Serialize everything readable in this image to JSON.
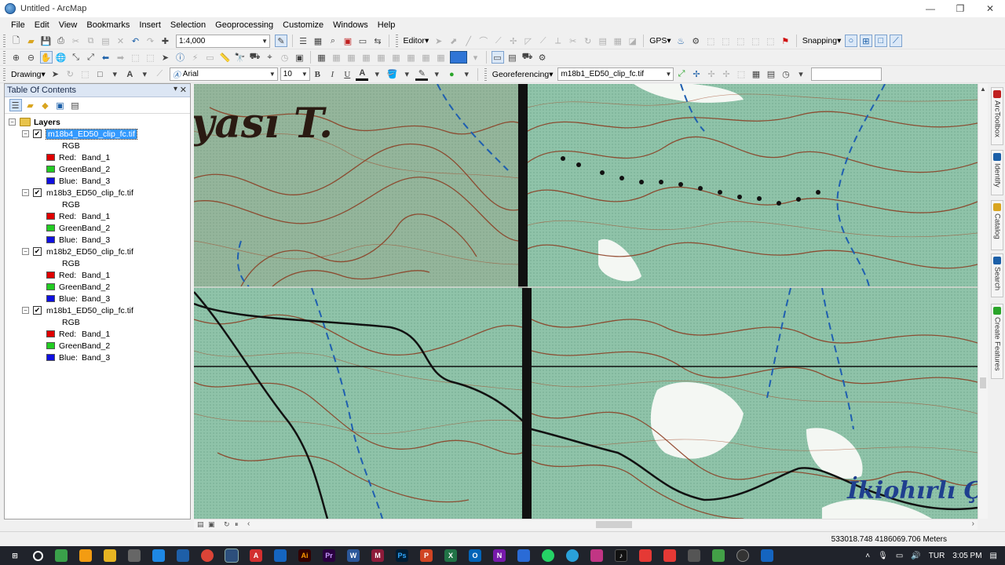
{
  "window": {
    "title": "Untitled - ArcMap",
    "min": "—",
    "restore": "❐",
    "close": "✕"
  },
  "menu": [
    "File",
    "Edit",
    "View",
    "Bookmarks",
    "Insert",
    "Selection",
    "Geoprocessing",
    "Customize",
    "Windows",
    "Help"
  ],
  "toolbar": {
    "scale": "1:4,000",
    "editor_label": "Editor",
    "gps_label": "GPS",
    "snapping_label": "Snapping",
    "drawing_label": "Drawing",
    "font_name": "Arial",
    "font_size": "10",
    "bold": "B",
    "italic": "I",
    "underline": "U",
    "font_color": "A",
    "georef_label": "Georeferencing",
    "georef_layer": "m18b1_ED50_clip_fc.tif"
  },
  "toc": {
    "title": "Table Of Contents",
    "pin": "▾",
    "close": "✕",
    "root": "Layers",
    "layers": [
      {
        "name": "m18b4_ED50_clip_fc.tif",
        "selected": true,
        "checked": true,
        "render": "RGB",
        "bands": [
          {
            "label": "Red:",
            "band": "Band_1",
            "color": "#e00000"
          },
          {
            "label": "Green:",
            "band": "Band_2",
            "color": "#22cc22"
          },
          {
            "label": "Blue:",
            "band": "Band_3",
            "color": "#1010e0"
          }
        ]
      },
      {
        "name": "m18b3_ED50_clip_fc.tif",
        "selected": false,
        "checked": true,
        "render": "RGB",
        "bands": [
          {
            "label": "Red:",
            "band": "Band_1",
            "color": "#e00000"
          },
          {
            "label": "Green:",
            "band": "Band_2",
            "color": "#22cc22"
          },
          {
            "label": "Blue:",
            "band": "Band_3",
            "color": "#1010e0"
          }
        ]
      },
      {
        "name": "m18b2_ED50_clip_fc.tif",
        "selected": false,
        "checked": true,
        "render": "RGB",
        "bands": [
          {
            "label": "Red:",
            "band": "Band_1",
            "color": "#e00000"
          },
          {
            "label": "Green:",
            "band": "Band_2",
            "color": "#22cc22"
          },
          {
            "label": "Blue:",
            "band": "Band_3",
            "color": "#1010e0"
          }
        ]
      },
      {
        "name": "m18b1_ED50_clip_fc.tif",
        "selected": false,
        "checked": true,
        "render": "RGB",
        "bands": [
          {
            "label": "Red:",
            "band": "Band_1",
            "color": "#e00000"
          },
          {
            "label": "Green:",
            "band": "Band_2",
            "color": "#22cc22"
          },
          {
            "label": "Blue:",
            "band": "Band_3",
            "color": "#1010e0"
          }
        ]
      }
    ]
  },
  "map": {
    "label_top": "yası T.",
    "label_bottom": "İkiohırlı Ç"
  },
  "right_tabs": [
    "ArcToolbox",
    "Identify",
    "Catalog",
    "Search",
    "Create Features"
  ],
  "status": {
    "coords": "533018.748  4186069.706 Meters"
  },
  "taskbar": {
    "lang": "TUR",
    "time": "3:05 PM"
  },
  "colors": {
    "contour": "#8b3a1f",
    "map_green": "#8bbfa6",
    "stream": "#1f5fb0",
    "selection": "#3399ff"
  }
}
